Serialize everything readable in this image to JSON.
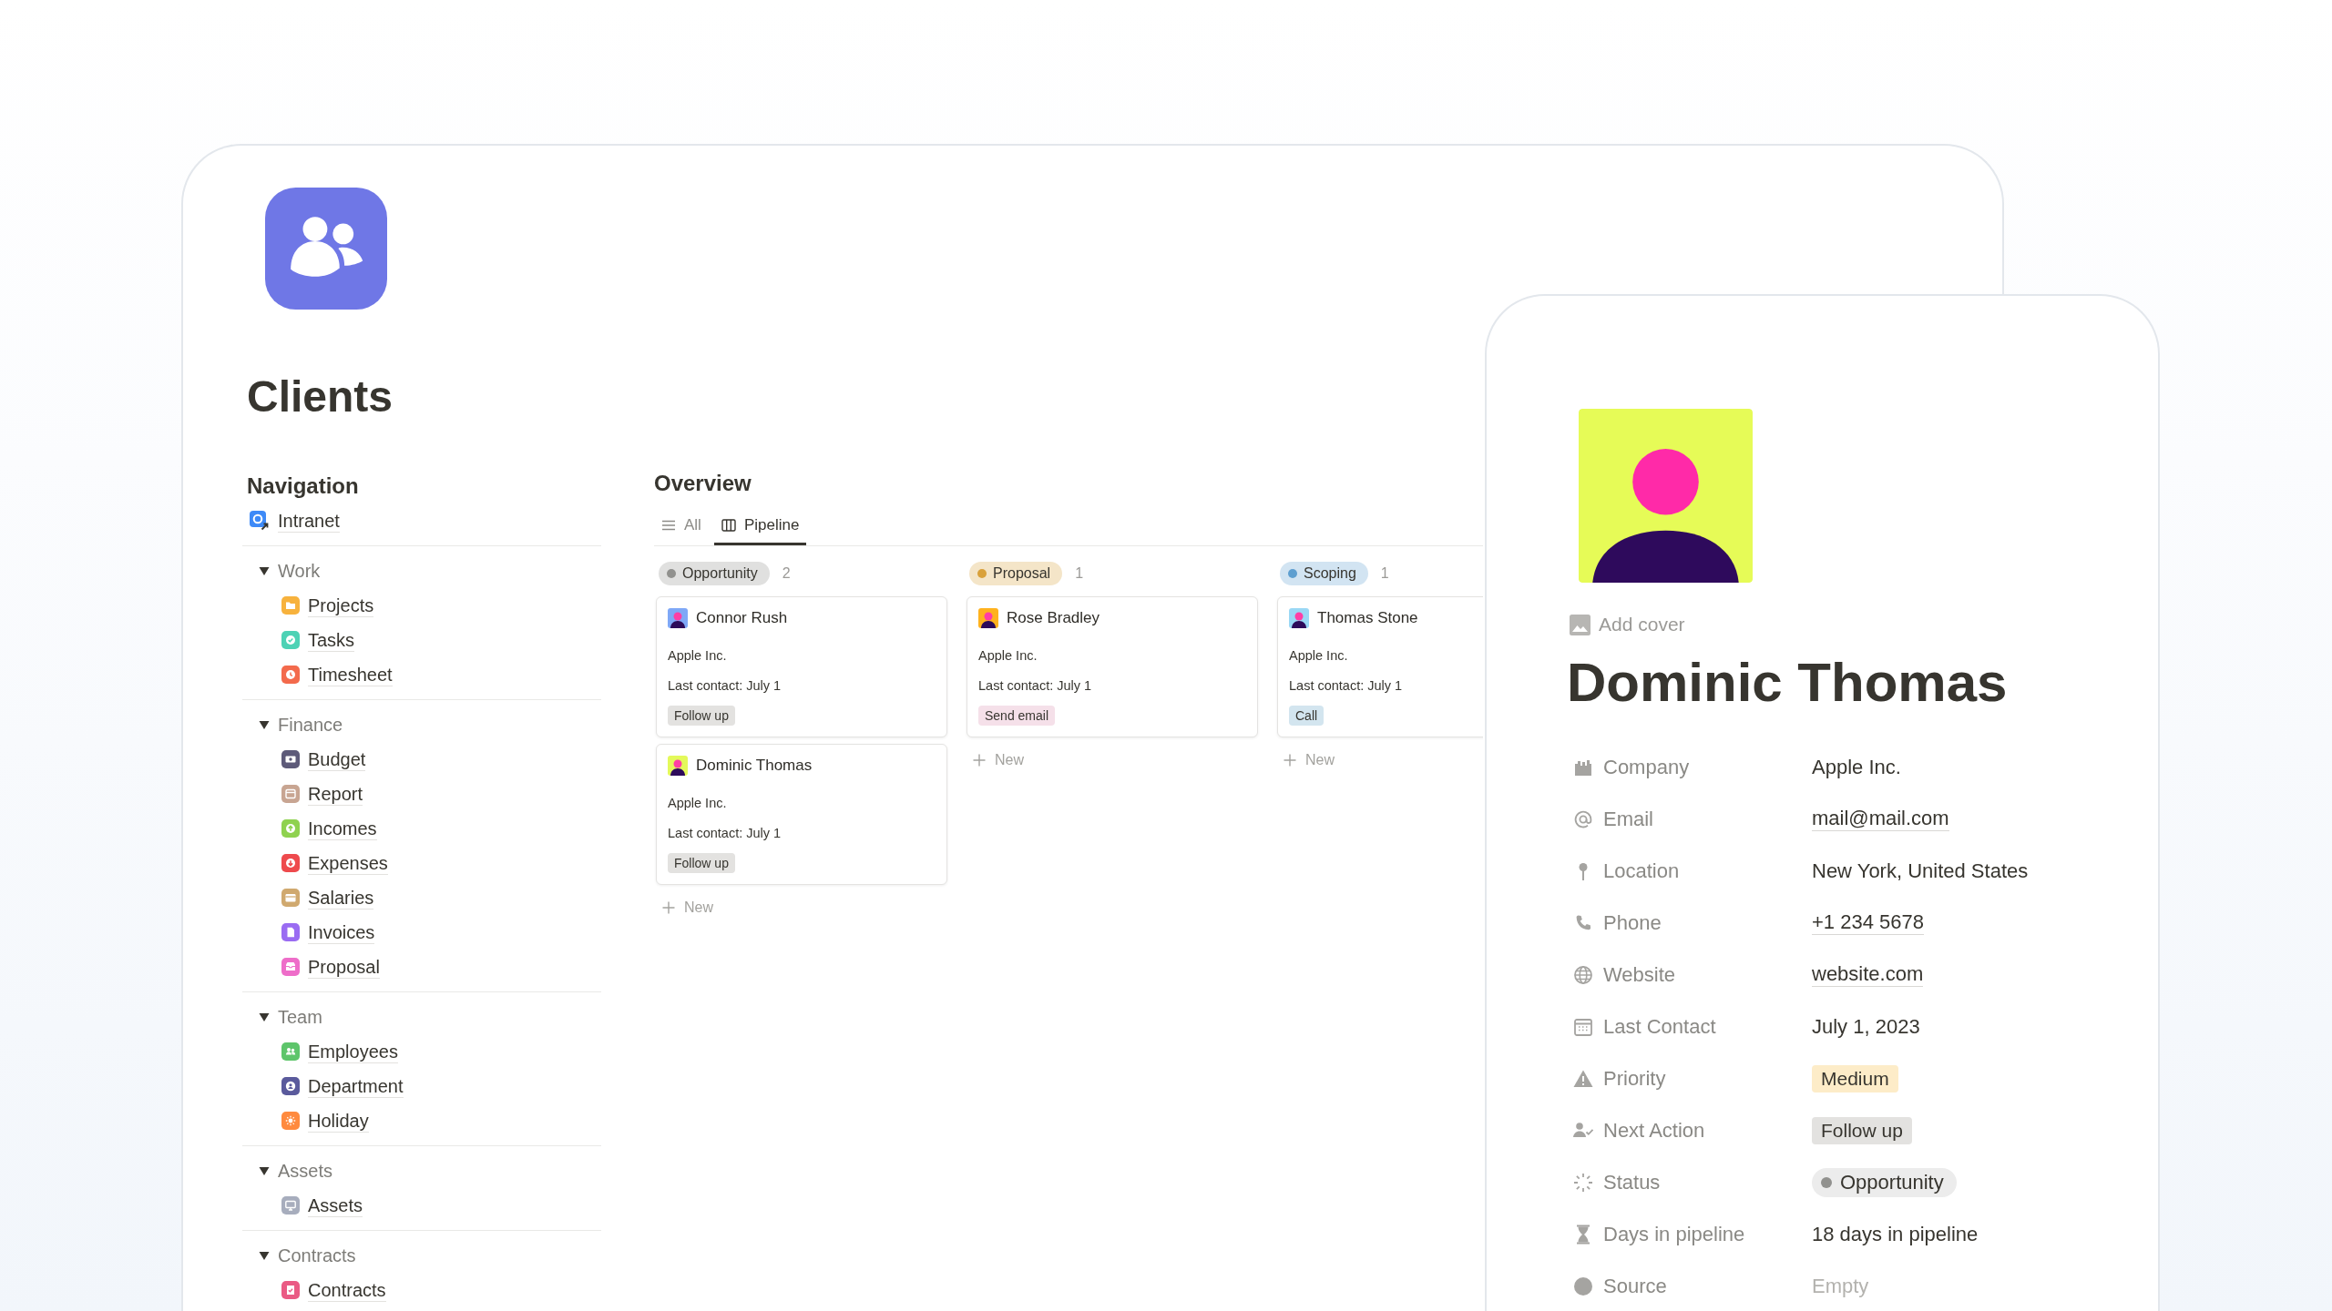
{
  "page": {
    "title": "Clients"
  },
  "navigation": {
    "heading": "Navigation",
    "links": [
      {
        "label": "Intranet"
      }
    ],
    "groups": [
      {
        "label": "Work",
        "expanded": true,
        "children": [
          {
            "label": "Projects"
          },
          {
            "label": "Tasks"
          },
          {
            "label": "Timesheet"
          }
        ]
      },
      {
        "label": "Finance",
        "expanded": true,
        "children": [
          {
            "label": "Budget"
          },
          {
            "label": "Report"
          },
          {
            "label": "Incomes"
          },
          {
            "label": "Expenses"
          },
          {
            "label": "Salaries"
          },
          {
            "label": "Invoices"
          },
          {
            "label": "Proposal"
          }
        ]
      },
      {
        "label": "Team",
        "expanded": true,
        "children": [
          {
            "label": "Employees"
          },
          {
            "label": "Department"
          },
          {
            "label": "Holiday"
          }
        ]
      },
      {
        "label": "Assets",
        "expanded": true,
        "children": [
          {
            "label": "Assets"
          }
        ]
      },
      {
        "label": "Contracts",
        "expanded": true,
        "children": [
          {
            "label": "Contracts"
          }
        ]
      }
    ]
  },
  "overview": {
    "heading": "Overview",
    "tabs": [
      {
        "label": "All",
        "selected": false
      },
      {
        "label": "Pipeline",
        "selected": true
      }
    ],
    "columns": [
      {
        "label": "Opportunity",
        "color": "#91918e",
        "count": "2",
        "cards": [
          {
            "name": "Connor Rush",
            "color": "#7fa8f7",
            "company": "Apple Inc.",
            "last_contact": "Last contact: July 1",
            "tag": {
              "label": "Follow up",
              "color": "#e3e2e0"
            }
          },
          {
            "name": "Dominic Thomas",
            "color": "#e4f95a",
            "company": "Apple Inc.",
            "last_contact": "Last contact: July 1",
            "tag": {
              "label": "Follow up",
              "color": "#e3e2e0"
            }
          }
        ],
        "new_label": "New"
      },
      {
        "label": "Proposal",
        "color": "#d9a13b",
        "count": "1",
        "cards": [
          {
            "name": "Rose Bradley",
            "color": "#ffb21e",
            "company": "Apple Inc.",
            "last_contact": "Last contact: July 1",
            "tag": {
              "label": "Send email",
              "color": "#f5e0e9"
            }
          }
        ],
        "new_label": "New"
      },
      {
        "label": "Scoping",
        "color": "#5e9fd0",
        "count": "1",
        "cards": [
          {
            "name": "Thomas Stone",
            "color": "#9ad8f5",
            "company": "Apple Inc.",
            "last_contact": "Last contact: July 1",
            "tag": {
              "label": "Call",
              "color": "#d3e5ef"
            }
          }
        ],
        "new_label": "New"
      }
    ]
  },
  "record": {
    "add_cover": "Add cover",
    "title": "Dominic Thomas",
    "properties": [
      {
        "label": "Company",
        "kind": "text",
        "value": "Apple Inc."
      },
      {
        "label": "Email",
        "kind": "link",
        "value": "mail@mail.com"
      },
      {
        "label": "Location",
        "kind": "text",
        "value": "New York, United States"
      },
      {
        "label": "Phone",
        "kind": "link",
        "value": "+1 234 5678"
      },
      {
        "label": "Website",
        "kind": "link",
        "value": "website.com"
      },
      {
        "label": "Last Contact",
        "kind": "text",
        "value": "July 1, 2023"
      },
      {
        "label": "Priority",
        "kind": "tag",
        "value": "Medium",
        "color": "#fdecc8"
      },
      {
        "label": "Next Action",
        "kind": "tag",
        "value": "Follow up",
        "color": "#e3e2e0"
      },
      {
        "label": "Status",
        "kind": "status",
        "value": "Opportunity",
        "color": "#91918e"
      },
      {
        "label": "Days in pipeline",
        "kind": "text",
        "value": "18 days in pipeline"
      },
      {
        "label": "Source",
        "kind": "empty",
        "placeholder": "Empty"
      }
    ]
  }
}
